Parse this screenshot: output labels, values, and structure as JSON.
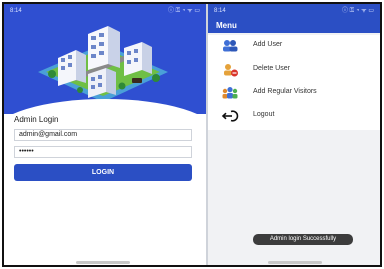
{
  "left_screen": {
    "status": {
      "time": "8:14",
      "icons": "ⓘ ⚿ ◔ ᯤ ▭"
    },
    "login": {
      "title": "Admin Login",
      "email_value": "admin@gmail.com",
      "password_value": "••••••",
      "button_label": "LOGIN"
    }
  },
  "right_screen": {
    "status": {
      "time": "8:14",
      "icons": "ⓘ ⚿ ◔ ᯤ ▭"
    },
    "header": {
      "title": "Menu"
    },
    "menu_items": [
      {
        "label": "Add User",
        "icon": "add-user-icon"
      },
      {
        "label": "Delete User",
        "icon": "delete-user-icon"
      },
      {
        "label": "Add Regular Visitors",
        "icon": "visitors-icon"
      },
      {
        "label": "Logout",
        "icon": "logout-icon"
      }
    ],
    "toast": "Admin login Successfully"
  },
  "colors": {
    "primary_blue": "#2b4fc4",
    "hero_blue": "#2f4fd1",
    "menu_background": "#f1f2f4",
    "toast": "#3c3c3c"
  }
}
